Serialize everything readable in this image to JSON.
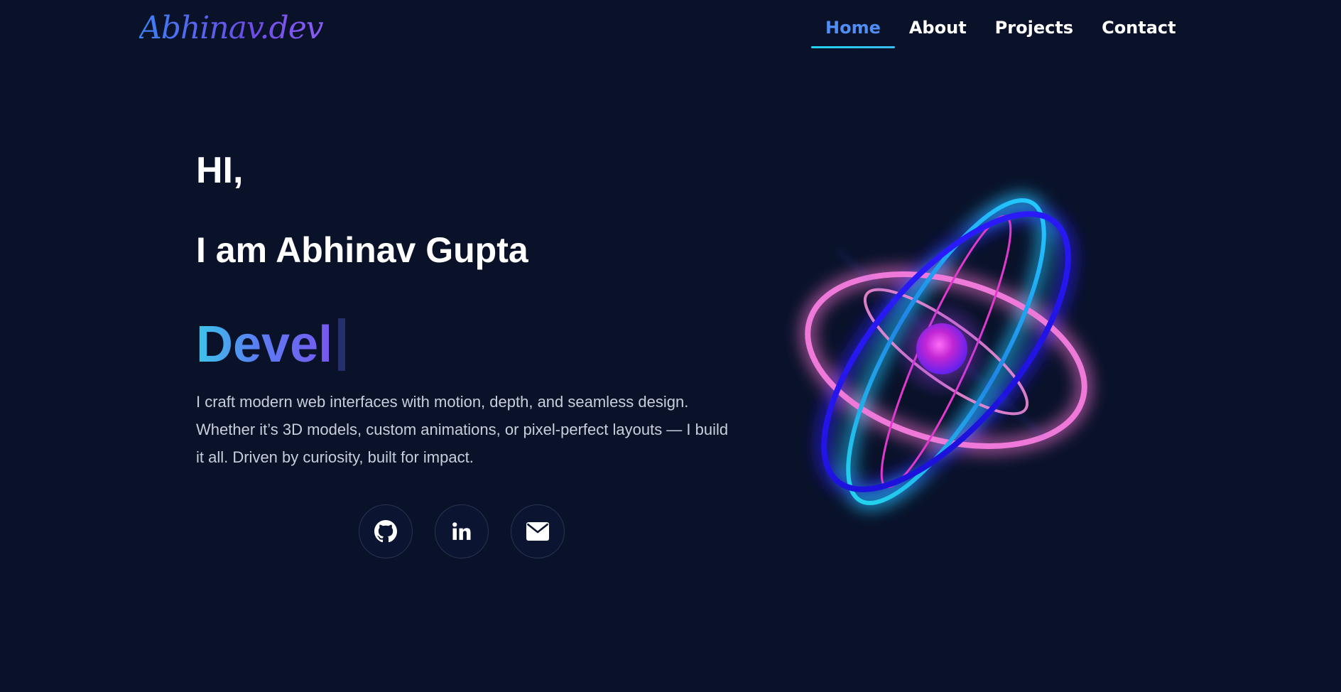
{
  "nav": {
    "logo": "Abhinav.dev",
    "links": [
      {
        "label": "Home",
        "active": true
      },
      {
        "label": "About",
        "active": false
      },
      {
        "label": "Projects",
        "active": false
      },
      {
        "label": "Contact",
        "active": false
      }
    ]
  },
  "hero": {
    "greeting": "HI,",
    "name": "I am Abhinav Gupta",
    "typed_text": "Devel",
    "bio": "I craft modern web interfaces with motion, depth, and seamless design. Whether it’s 3D models, custom animations, or pixel-perfect layouts — I build it all. Driven by curiosity, built for impact."
  },
  "socials": [
    {
      "icon": "github-icon"
    },
    {
      "icon": "linkedin-icon"
    },
    {
      "icon": "mail-icon"
    }
  ],
  "colors": {
    "background": "#0a122a",
    "accent_blue": "#4f8ef7",
    "accent_cyan": "#22d3ee",
    "accent_purple": "#7857ef",
    "accent_pink": "#f472d0",
    "core_magenta": "#c026d3"
  }
}
